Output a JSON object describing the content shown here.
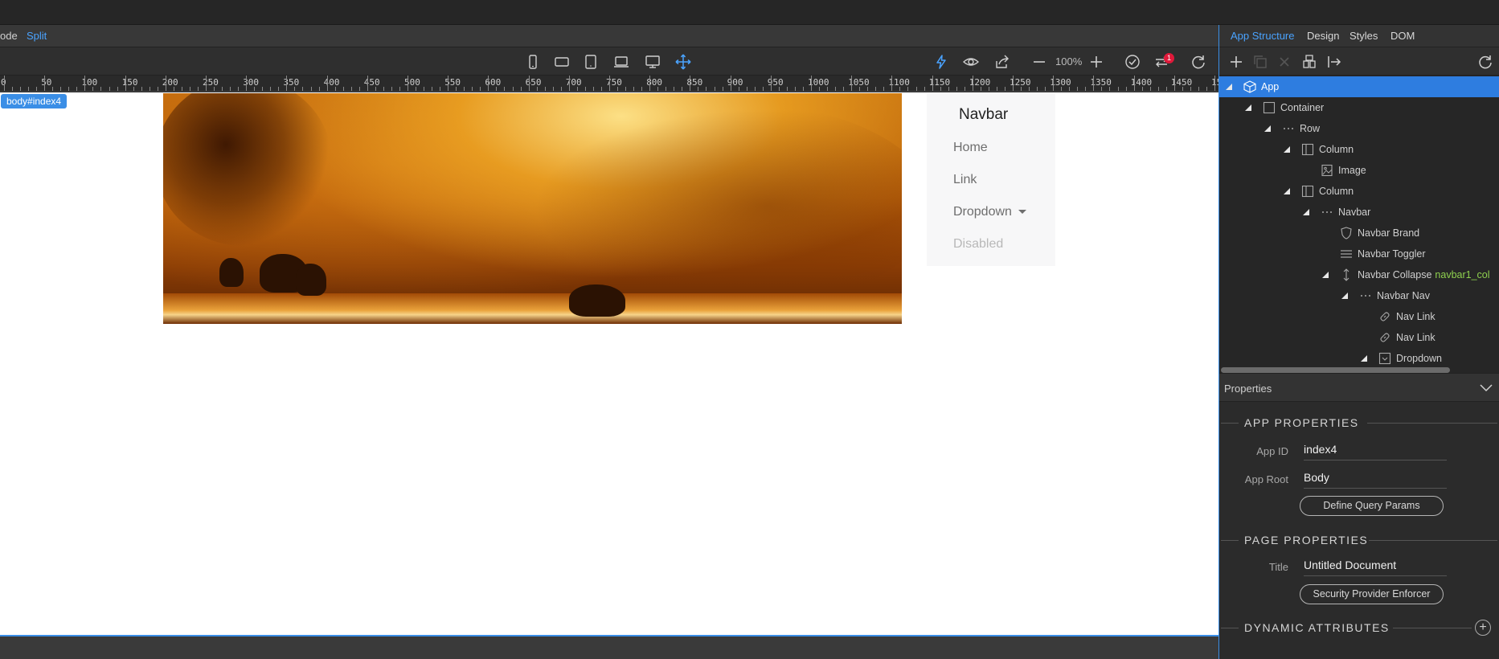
{
  "mode_bar": {
    "code_label": "ode",
    "split_label": "Split"
  },
  "toolbar": {
    "zoom": "100%",
    "notification_count": "1"
  },
  "ruler": {
    "labels": [
      "0",
      "50",
      "100",
      "150",
      "200",
      "250",
      "300",
      "350",
      "400",
      "450",
      "500",
      "550",
      "600",
      "650",
      "700",
      "750",
      "800",
      "850",
      "900",
      "950",
      "1000",
      "1050",
      "1100",
      "1150",
      "1200",
      "1250",
      "1300",
      "1350",
      "1400",
      "1450",
      "15"
    ]
  },
  "canvas": {
    "body_tag": "body#index4",
    "navbar": {
      "brand": "Navbar",
      "home": "Home",
      "link": "Link",
      "dropdown": "Dropdown",
      "disabled": "Disabled"
    }
  },
  "right_panel": {
    "tabs": {
      "app_structure": "App Structure",
      "design": "Design",
      "styles": "Styles",
      "dom": "DOM"
    },
    "tree": [
      {
        "label": "App",
        "icon": "cube-icon",
        "selected": true
      },
      {
        "label": "Container",
        "icon": "container-icon"
      },
      {
        "label": "Row",
        "icon": "dots-icon"
      },
      {
        "label": "Column",
        "icon": "column-icon"
      },
      {
        "label": "Image",
        "icon": "image-icon"
      },
      {
        "label": "Column",
        "icon": "column-icon"
      },
      {
        "label": "Navbar",
        "icon": "dots-icon"
      },
      {
        "label": "Navbar Brand",
        "icon": "shield-icon"
      },
      {
        "label": "Navbar Toggler",
        "icon": "menu-icon"
      },
      {
        "label": "Navbar Collapse",
        "icon": "collapse-icon",
        "extra": "navbar1_col"
      },
      {
        "label": "Navbar Nav",
        "icon": "dots-icon"
      },
      {
        "label": "Nav Link",
        "icon": "link-icon"
      },
      {
        "label": "Nav Link",
        "icon": "link-icon"
      },
      {
        "label": "Dropdown",
        "icon": "dropdown-icon"
      }
    ],
    "properties": {
      "header": "Properties",
      "app_properties_title": "APP PROPERTIES",
      "app_id_label": "App ID",
      "app_id_value": "index4",
      "app_root_label": "App Root",
      "app_root_value": "Body",
      "define_query_params": "Define Query Params",
      "page_properties_title": "PAGE PROPERTIES",
      "title_label": "Title",
      "title_value": "Untitled Document",
      "security_provider_enforcer": "Security Provider Enforcer",
      "dynamic_attributes_title": "DYNAMIC ATTRIBUTES"
    }
  },
  "colors": {
    "accent": "#3a8ee6",
    "selection": "#2e7de0",
    "extra_text": "#8fd14f",
    "badge": "#e0193a"
  }
}
